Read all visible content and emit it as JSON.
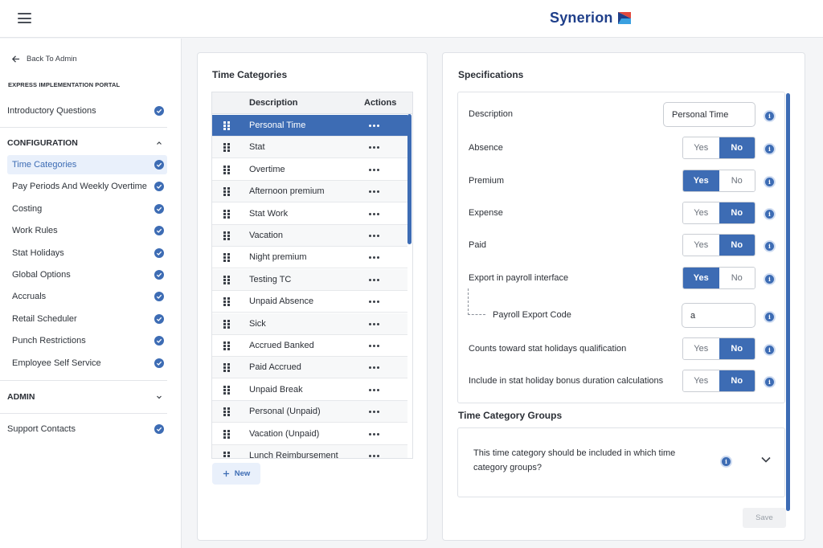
{
  "brand": {
    "name": "Synerion",
    "colors": {
      "primary": "#1f3f8a",
      "accent": "#3d6cb4",
      "logo_red": "#e2483d"
    }
  },
  "sidebar": {
    "back_label": "Back To Admin",
    "portal_label": "EXPRESS IMPLEMENTATION PORTAL",
    "intro_label": "Introductory Questions",
    "configuration_label": "CONFIGURATION",
    "config_items": [
      {
        "label": "Time Categories",
        "active": true
      },
      {
        "label": "Pay Periods And Weekly Overtime"
      },
      {
        "label": "Costing"
      },
      {
        "label": "Work Rules"
      },
      {
        "label": "Stat Holidays"
      },
      {
        "label": "Global Options"
      },
      {
        "label": "Accruals"
      },
      {
        "label": "Retail Scheduler"
      },
      {
        "label": "Punch Restrictions"
      },
      {
        "label": "Employee Self Service"
      }
    ],
    "admin_label": "ADMIN",
    "support_label": "Support Contacts"
  },
  "time_categories": {
    "title": "Time Categories",
    "col_description": "Description",
    "col_actions": "Actions",
    "rows": [
      "Personal Time",
      "Stat",
      "Overtime",
      "Afternoon premium",
      "Stat Work",
      "Vacation",
      "Night premium",
      "Testing TC",
      "Unpaid Absence",
      "Sick",
      "Accrued Banked",
      "Paid Accrued",
      "Unpaid Break",
      "Personal (Unpaid)",
      "Vacation (Unpaid)",
      "Lunch Reimbursement"
    ],
    "selected_index": 0,
    "new_label": "New"
  },
  "specifications": {
    "title": "Specifications",
    "description_label": "Description",
    "description_value": "Personal Time",
    "yes_label": "Yes",
    "no_label": "No",
    "toggles": [
      {
        "label": "Absence",
        "value": "No"
      },
      {
        "label": "Premium",
        "value": "Yes"
      },
      {
        "label": "Expense",
        "value": "No"
      },
      {
        "label": "Paid",
        "value": "No"
      },
      {
        "label": "Export in payroll interface",
        "value": "Yes"
      },
      {
        "label": "Counts toward stat holidays qualification",
        "value": "No"
      },
      {
        "label": "Include in stat holiday bonus duration calculations",
        "value": "No"
      }
    ],
    "payroll_code_label": "Payroll Export Code",
    "payroll_code_value": "a",
    "info_glyph": "i"
  },
  "groups": {
    "title": "Time Category Groups",
    "question": "This time category should be included in which time category groups?"
  },
  "save_label": "Save"
}
